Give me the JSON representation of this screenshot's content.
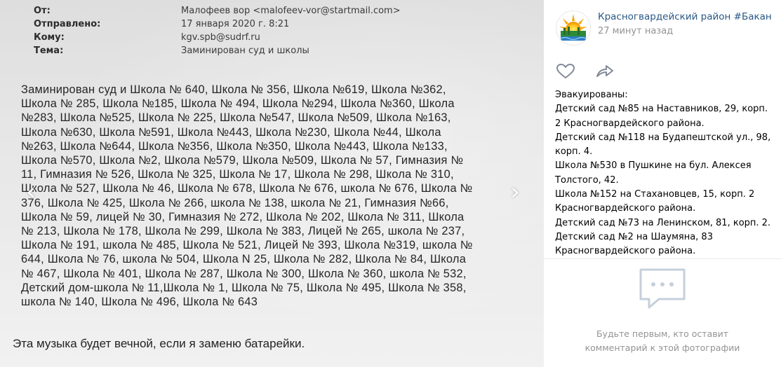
{
  "photo": {
    "email_header": [
      {
        "key": "От:",
        "value": "Малофеев вор <malofeev-vor@startmail.com>"
      },
      {
        "key": "Отправлено:",
        "value": "17 января 2020 г. 8:21"
      },
      {
        "key": "Кому:",
        "value": "kgv.spb@sudrf.ru"
      },
      {
        "key": "Тема:",
        "value": "Заминирован суд и школы"
      }
    ],
    "body_lines": [
      "Заминирован суд и Школа № 640, Школа № 356, Школа №619, Школа №362,",
      "Школа № 285, Школа №185, Школа № 494, Школа №294, Школа №360, Школа",
      "№283, Школа №525, Школа № 225, Школа №547, Школа №509, Школа №163,",
      "Школа №630, Школа №591, Школа №443, Школа №230, Школа №44, Школа",
      "№263, Школа №644, Школа №356, Школа №350, Школа №443, Школа №133,",
      "Школа №570, Школа №2, Школа №579, Школа №509, Школа № 57, Гимназия №",
      "11, Гимназия № 526, Школа № 325, Школа № 17, Школа № 298, Школа № 310,",
      "Школа № 527, Школа № 46, Школа № 678, Школа № 676, школа № 676, Школа №",
      "376, Школа № 425, Школа № 266, школа № 138, школа № 21, Гимназия №66,",
      "Школа № 59, лицей № 30, Гимназия № 272, Школа № 202, Школа № 311, Школа",
      "№ 213, Школа № 178, Школа № 299, Школа № 383, Лицей № 265, школа № 237,",
      "Школа № 191, школа № 485, Школа № 521, Лицей № 393, Школа №319, школа №",
      "644, Школа № 76, школа № 504, Школа N 25, Школа № 282, Школа № 84, Школа",
      "№ 467, Школа № 401, Школа № 287, Школа № 300, Школа № 360, школа № 532,",
      "Детский дом-школа № 11,Школа № 1, Школа № 75, Школа № 495, Школа № 358,",
      "школа № 140, Школа № 496, Школа № 643"
    ],
    "closing": "Эта музыка будет вечной, если я заменю батарейки.",
    "nav_prev": "‹",
    "nav_next": "›"
  },
  "sidebar": {
    "author_name": "Красногвардейский район #Бакан",
    "time": "27 минут назад",
    "like_icon": "heart-icon",
    "share_icon": "share-arrow-icon",
    "description": [
      "Эвакуированы:",
      "Детский сад №85 на Наставников, 29, корп.",
      "2 Красногвардейского района.",
      "Детский сад №118 на Будапештской ул., 98,",
      "корп. 4.",
      "Школа №530 в Пушкине на бул. Алексея",
      "Толстого, 42.",
      "Школа №152 на Стахановцев, 15, корп. 2",
      "Красногвардейского района.",
      "Детский сад №73 на Ленинском, 81, корп. 2.",
      "Детский сад №2 на Шаумяна, 83",
      "Красногвардейского района."
    ],
    "empty_comments": [
      "Будьте первым, кто оставит",
      "комментарий к этой фотографии"
    ]
  },
  "colors": {
    "link": "#2a5885",
    "muted": "#939393",
    "divider": "#e7e8ec"
  }
}
